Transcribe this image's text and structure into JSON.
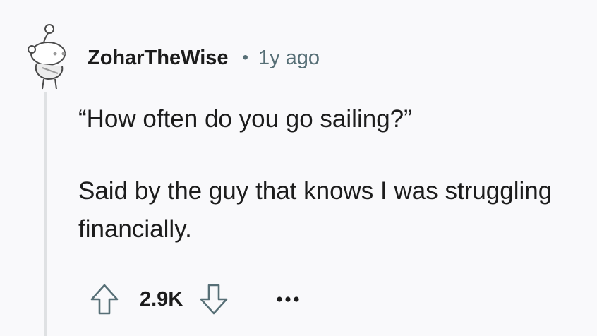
{
  "comment": {
    "author": "ZoharTheWise",
    "separator": "•",
    "timestamp": "1y ago",
    "paragraphs": [
      "“How often do you go sailing?”",
      "Said by the guy that knows I was struggling financially."
    ],
    "score": "2.9K"
  },
  "icons": {
    "avatar": "snoo-avatar-icon",
    "upvote": "arrow-up-outline-icon",
    "downvote": "arrow-down-outline-icon",
    "more": "more-horizontal-dots-icon"
  },
  "colors": {
    "background": "#f9f9fb",
    "text": "#1c1c1c",
    "meta": "#576f76",
    "thread_line": "#dfe1e3"
  }
}
